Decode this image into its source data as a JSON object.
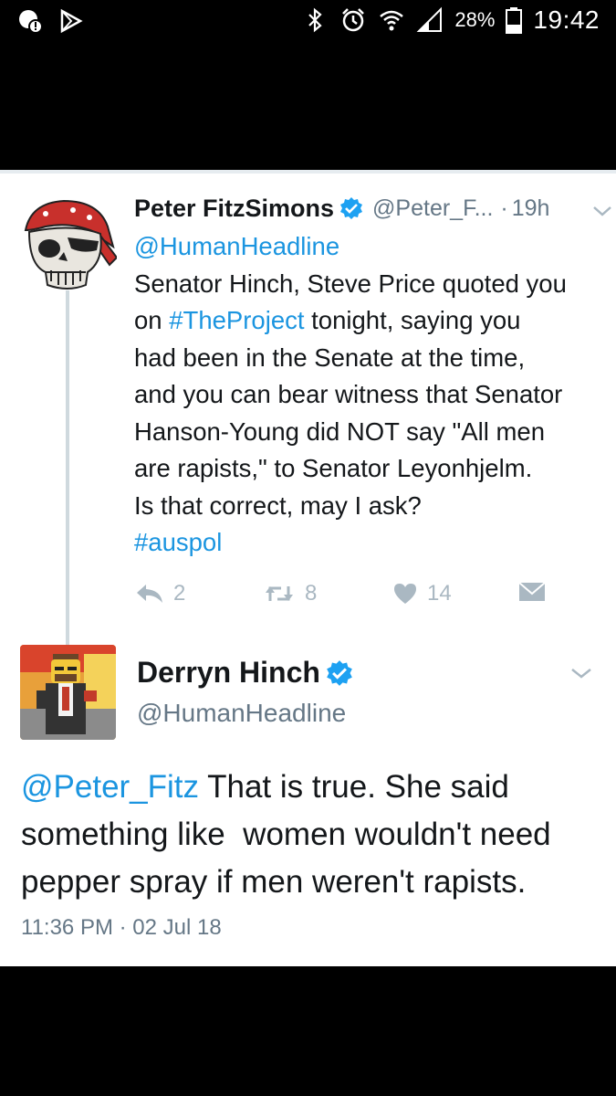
{
  "status_bar": {
    "battery": "28%",
    "time": "19:42"
  },
  "tweet1": {
    "name": "Peter FitzSimons",
    "handle": "@Peter_F...",
    "separator": "·",
    "time": "19h",
    "body_lines": [
      "@HumanHeadline",
      "Senator Hinch, Steve Price quoted you",
      "on #TheProject tonight, saying you",
      "had been in the Senate at the time,",
      "and you can bear witness that Senator",
      "Hanson-Young did NOT say \"All men",
      "are rapists,\" to Senator Leyonhjelm.",
      "Is that correct, may I ask?",
      "#auspol"
    ],
    "mention": "@HumanHeadline",
    "line3_prefix": "on ",
    "hashtag1": "#TheProject",
    "line3_suffix": " tonight, saying you",
    "hashtag2": "#auspol",
    "reply_count": "2",
    "retweet_count": "8",
    "like_count": "14"
  },
  "tweet2": {
    "name": "Derryn Hinch",
    "handle": "@HumanHeadline",
    "mention": "@Peter_Fitz",
    "line1_suffix": " That is true. She said",
    "line2": "something like  women wouldn't need",
    "line3": "pepper spray if men weren't rapists.",
    "timestamp": "11:36 PM · 02 Jul 18"
  },
  "colors": {
    "link": "#1b95e0",
    "verified": "#1da1f2",
    "secondary_text": "#657786",
    "action_icons": "#aab8c2"
  }
}
